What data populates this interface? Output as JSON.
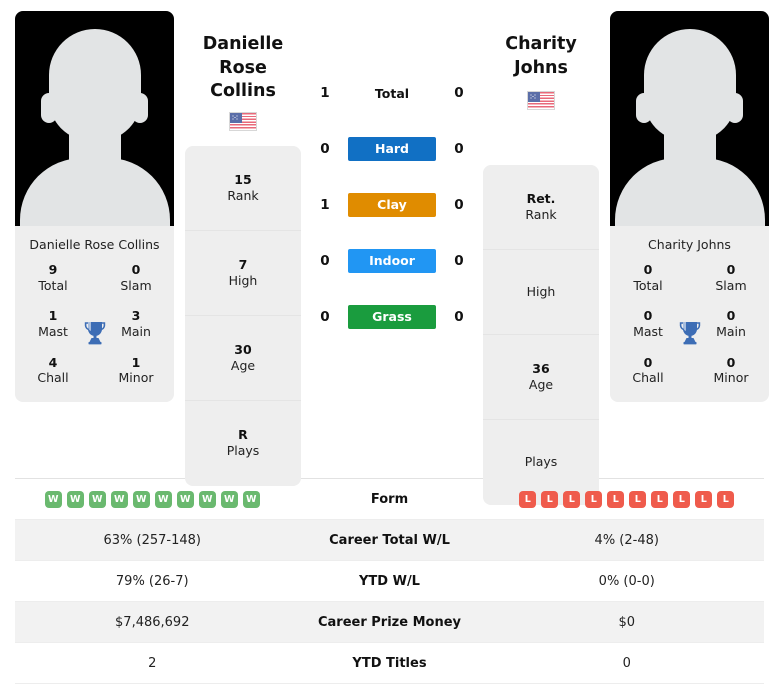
{
  "players": {
    "left": {
      "full_name": "Danielle Rose Collins",
      "name_line1": "Danielle Rose",
      "name_line2": "Collins",
      "country_flag": "us-flag-icon",
      "caption": "Danielle Rose Collins",
      "titles": {
        "total_value": "9",
        "total_label": "Total",
        "slam_value": "0",
        "slam_label": "Slam",
        "mast_value": "1",
        "mast_label": "Mast",
        "main_value": "3",
        "main_label": "Main",
        "chall_value": "4",
        "chall_label": "Chall",
        "minor_value": "1",
        "minor_label": "Minor"
      },
      "info": [
        {
          "value": "15",
          "label": "Rank"
        },
        {
          "value": "7",
          "label": "High"
        },
        {
          "value": "30",
          "label": "Age"
        },
        {
          "value": "R",
          "label": "Plays"
        }
      ],
      "form": [
        "W",
        "W",
        "W",
        "W",
        "W",
        "W",
        "W",
        "W",
        "W",
        "W"
      ],
      "career_total_wl": "63% (257-148)",
      "ytd_wl": "79% (26-7)",
      "career_prize_money": "$7,486,692",
      "ytd_titles": "2"
    },
    "right": {
      "full_name": "Charity Johns",
      "name_line1": "Charity",
      "name_line2": "Johns",
      "country_flag": "us-flag-icon",
      "caption": "Charity Johns",
      "titles": {
        "total_value": "0",
        "total_label": "Total",
        "slam_value": "0",
        "slam_label": "Slam",
        "mast_value": "0",
        "mast_label": "Mast",
        "main_value": "0",
        "main_label": "Main",
        "chall_value": "0",
        "chall_label": "Chall",
        "minor_value": "0",
        "minor_label": "Minor"
      },
      "info": [
        {
          "value": "Ret.",
          "label": "Rank"
        },
        {
          "value": "",
          "label": "High"
        },
        {
          "value": "36",
          "label": "Age"
        },
        {
          "value": "",
          "label": "Plays"
        }
      ],
      "form": [
        "L",
        "L",
        "L",
        "L",
        "L",
        "L",
        "L",
        "L",
        "L",
        "L"
      ],
      "career_total_wl": "4% (2-48)",
      "ytd_wl": "0% (0-0)",
      "career_prize_money": "$0",
      "ytd_titles": "0"
    }
  },
  "head_to_head": [
    {
      "label": "Total",
      "left": "1",
      "right": "0",
      "style": "plain",
      "color": ""
    },
    {
      "label": "Hard",
      "left": "0",
      "right": "0",
      "style": "pill",
      "color": "#1170c4"
    },
    {
      "label": "Clay",
      "left": "1",
      "right": "0",
      "style": "pill",
      "color": "#e08c00"
    },
    {
      "label": "Indoor",
      "left": "0",
      "right": "0",
      "style": "pill",
      "color": "#2196f3"
    },
    {
      "label": "Grass",
      "left": "0",
      "right": "0",
      "style": "pill",
      "color": "#1a9c3e"
    }
  ],
  "stats_table": [
    {
      "label": "Form",
      "type": "form",
      "left": "",
      "right": ""
    },
    {
      "label": "Career Total W/L",
      "type": "text",
      "left": "63% (257-148)",
      "right": "4% (2-48)"
    },
    {
      "label": "YTD W/L",
      "type": "text",
      "left": "79% (26-7)",
      "right": "0% (0-0)"
    },
    {
      "label": "Career Prize Money",
      "type": "text",
      "left": "$7,486,692",
      "right": "$0"
    },
    {
      "label": "YTD Titles",
      "type": "text",
      "left": "2",
      "right": "0"
    }
  ],
  "icons": {
    "trophy": "trophy-icon",
    "flag": "us-flag-icon"
  },
  "colors": {
    "card_bg": "#eeeeee",
    "row_alt_bg": "#f2f2f2",
    "win_badge": "#6ab96f",
    "loss_badge": "#ef5b4c",
    "trophy": "#3d6db5"
  }
}
